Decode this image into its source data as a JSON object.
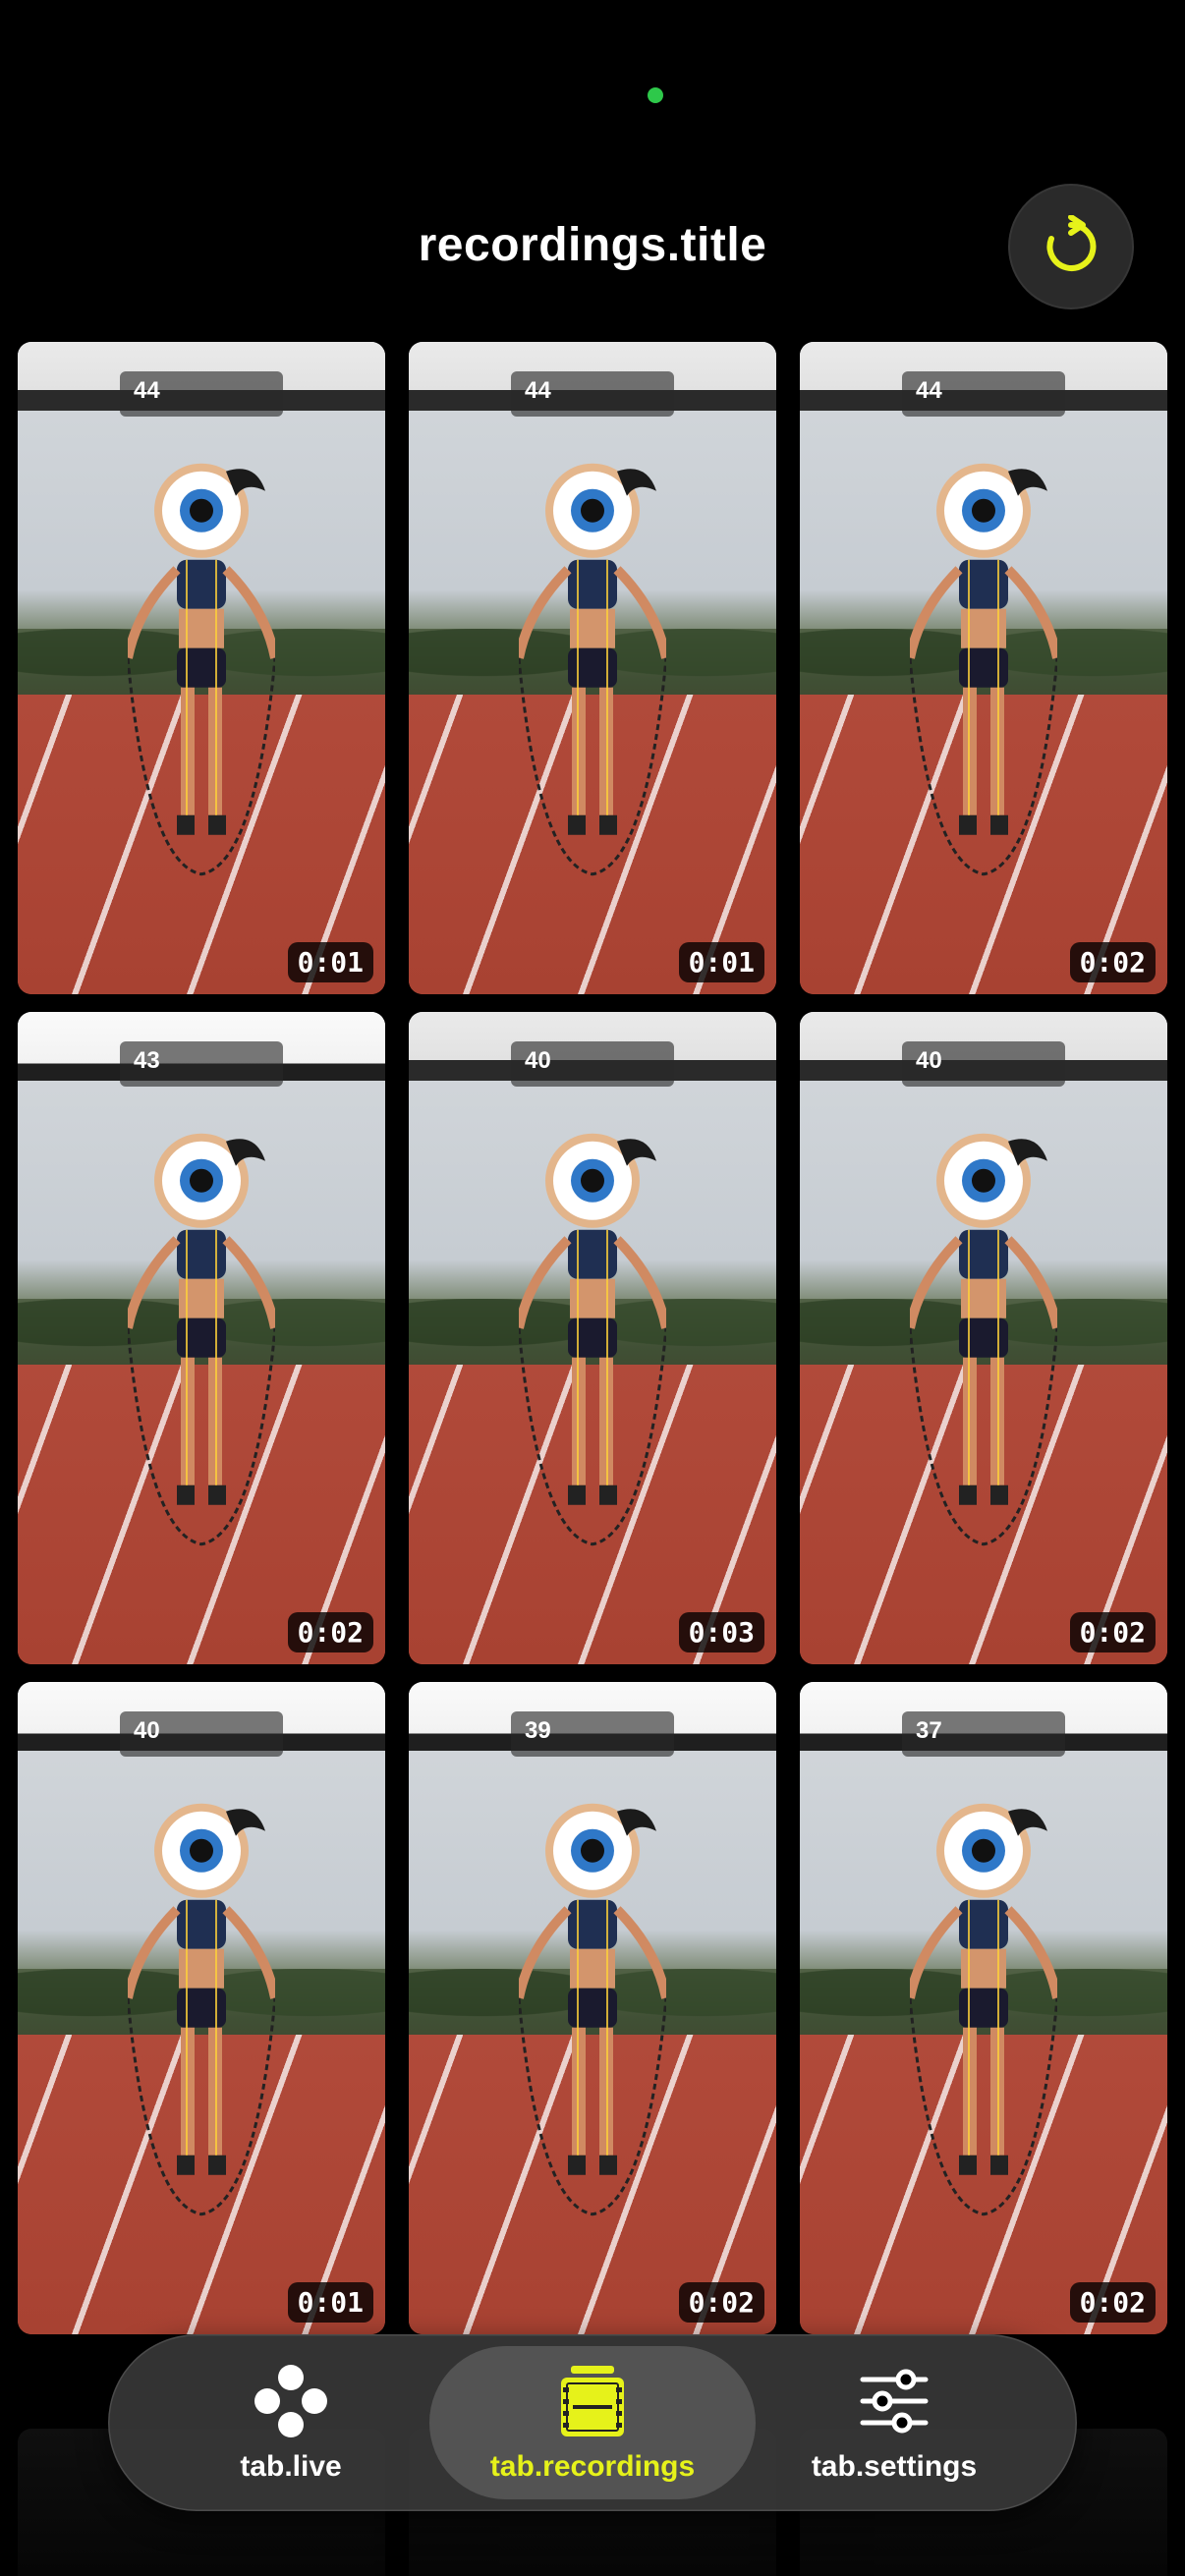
{
  "header": {
    "title": "recordings.title"
  },
  "recordings": [
    {
      "count": "44",
      "duration": "0:01"
    },
    {
      "count": "44",
      "duration": "0:01"
    },
    {
      "count": "44",
      "duration": "0:02"
    },
    {
      "count": "43",
      "duration": "0:02"
    },
    {
      "count": "40",
      "duration": "0:03"
    },
    {
      "count": "40",
      "duration": "0:02"
    },
    {
      "count": "40",
      "duration": "0:01"
    },
    {
      "count": "39",
      "duration": "0:02"
    },
    {
      "count": "37",
      "duration": "0:02"
    }
  ],
  "tabbar": {
    "live": "tab.live",
    "recordings": "tab.recordings",
    "settings": "tab.settings"
  },
  "colors": {
    "accent": "#e6f21a",
    "status_dot": "#2ec84a",
    "background": "#000000"
  },
  "icons": {
    "refresh": "refresh-icon",
    "live": "live-dots-icon",
    "recordings": "film-strip-icon",
    "settings": "sliders-icon"
  }
}
